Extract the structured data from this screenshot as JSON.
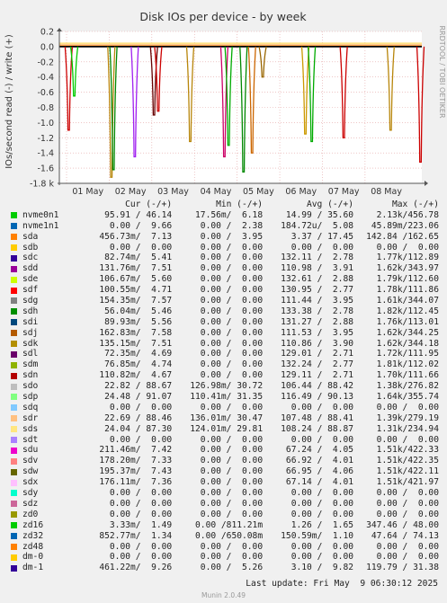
{
  "chart_data": {
    "type": "line",
    "title": "Disk IOs per device - by week",
    "ylabel": "IOs/second read (-) / write (+)",
    "y_ticks": [
      "0.2",
      "0.0",
      "-0.2",
      "-0.4",
      "-0.6",
      "-0.8",
      "-1.0",
      "-1.2",
      "-1.4",
      "-1.6",
      "-1.8 k"
    ],
    "y_tick_values": [
      0.2,
      0.0,
      -0.2,
      -0.4,
      -0.6,
      -0.8,
      -1.0,
      -1.2,
      -1.4,
      -1.6,
      -1.8
    ],
    "ylim": [
      -1.8,
      0.2
    ],
    "x_ticks": [
      "01 May",
      "02 May",
      "03 May",
      "04 May",
      "05 May",
      "06 May",
      "07 May",
      "08 May"
    ],
    "grid": true,
    "spikes": [
      {
        "day": 0.05,
        "value": -1.1,
        "color": "#cc0000"
      },
      {
        "day": 0.18,
        "value": -0.65,
        "color": "#00cc00"
      },
      {
        "day": 1.05,
        "value": -1.72,
        "color": "#b8860b"
      },
      {
        "day": 1.1,
        "value": -1.62,
        "color": "#008800"
      },
      {
        "day": 1.6,
        "value": -1.45,
        "color": "#a020f0"
      },
      {
        "day": 2.05,
        "value": -0.9,
        "color": "#660000"
      },
      {
        "day": 2.15,
        "value": -0.85,
        "color": "#cc0000"
      },
      {
        "day": 2.9,
        "value": -1.25,
        "color": "#b8860b"
      },
      {
        "day": 3.7,
        "value": -1.45,
        "color": "#cc0066"
      },
      {
        "day": 3.8,
        "value": -1.3,
        "color": "#00aa00"
      },
      {
        "day": 4.15,
        "value": -1.65,
        "color": "#008800"
      },
      {
        "day": 4.35,
        "value": -1.4,
        "color": "#cc6600"
      },
      {
        "day": 4.6,
        "value": -0.4,
        "color": "#996600"
      },
      {
        "day": 5.6,
        "value": -1.15,
        "color": "#cc9900"
      },
      {
        "day": 5.75,
        "value": -1.25,
        "color": "#00aa00"
      },
      {
        "day": 6.5,
        "value": -1.2,
        "color": "#cc0000"
      },
      {
        "day": 7.6,
        "value": -1.1,
        "color": "#b8860b"
      },
      {
        "day": 8.3,
        "value": -1.52,
        "color": "#cc0000"
      }
    ]
  },
  "side_text": "RRDTOOL / TOBI OETIKER",
  "legend": {
    "header": {
      "cur": "Cur (-/+)",
      "min": "Min (-/+)",
      "avg": "Avg (-/+)",
      "max": "Max (-/+)"
    },
    "rows": [
      {
        "name": "nvme0n1",
        "color": "#00cc00",
        "cur": "95.91 / 46.14",
        "min": "17.56m/  6.18",
        "avg": "14.99 / 35.60",
        "max": "2.13k/456.78"
      },
      {
        "name": "nvme1n1",
        "color": "#0066b3",
        "cur": "0.00 /  9.66",
        "min": "0.00 /  2.38",
        "avg": "184.72u/  5.08",
        "max": "45.89m/223.06"
      },
      {
        "name": "sda",
        "color": "#ff8000",
        "cur": "456.73m/  7.13",
        "min": "0.00 /  3.95",
        "avg": "3.37 / 17.45",
        "max": "142.84 /162.65"
      },
      {
        "name": "sdb",
        "color": "#ffcc00",
        "cur": "0.00 /  0.00",
        "min": "0.00 /  0.00",
        "avg": "0.00 /  0.00",
        "max": "0.00 /  0.00"
      },
      {
        "name": "sdc",
        "color": "#330099",
        "cur": "82.74m/  5.41",
        "min": "0.00 /  0.00",
        "avg": "132.11 /  2.78",
        "max": "1.77k/112.89"
      },
      {
        "name": "sdd",
        "color": "#990099",
        "cur": "131.76m/  7.51",
        "min": "0.00 /  0.00",
        "avg": "110.98 /  3.91",
        "max": "1.62k/343.97"
      },
      {
        "name": "sde",
        "color": "#ccff00",
        "cur": "106.67m/  5.60",
        "min": "0.00 /  0.00",
        "avg": "132.61 /  2.88",
        "max": "1.79k/112.60"
      },
      {
        "name": "sdf",
        "color": "#ff0000",
        "cur": "100.55m/  4.71",
        "min": "0.00 /  0.00",
        "avg": "130.95 /  2.77",
        "max": "1.78k/111.86"
      },
      {
        "name": "sdg",
        "color": "#808080",
        "cur": "154.35m/  7.57",
        "min": "0.00 /  0.00",
        "avg": "111.44 /  3.95",
        "max": "1.61k/344.07"
      },
      {
        "name": "sdh",
        "color": "#008f00",
        "cur": "56.04m/  5.46",
        "min": "0.00 /  0.00",
        "avg": "133.38 /  2.78",
        "max": "1.82k/112.45"
      },
      {
        "name": "sdi",
        "color": "#00487d",
        "cur": "89.93m/  5.56",
        "min": "0.00 /  0.00",
        "avg": "131.27 /  2.88",
        "max": "1.76k/113.01"
      },
      {
        "name": "sdj",
        "color": "#b35a00",
        "cur": "162.83m/  7.58",
        "min": "0.00 /  0.00",
        "avg": "111.53 /  3.95",
        "max": "1.62k/344.25"
      },
      {
        "name": "sdk",
        "color": "#b38f00",
        "cur": "135.15m/  7.51",
        "min": "0.00 /  0.00",
        "avg": "110.86 /  3.90",
        "max": "1.62k/344.18"
      },
      {
        "name": "sdl",
        "color": "#6b006b",
        "cur": "72.35m/  4.69",
        "min": "0.00 /  0.00",
        "avg": "129.01 /  2.71",
        "max": "1.72k/111.95"
      },
      {
        "name": "sdm",
        "color": "#8fb300",
        "cur": "76.85m/  4.74",
        "min": "0.00 /  0.00",
        "avg": "132.24 /  2.77",
        "max": "1.81k/112.02"
      },
      {
        "name": "sdn",
        "color": "#b30000",
        "cur": "110.82m/  4.67",
        "min": "0.00 /  0.00",
        "avg": "129.11 /  2.71",
        "max": "1.70k/111.66"
      },
      {
        "name": "sdo",
        "color": "#bebebe",
        "cur": "22.82 / 88.67",
        "min": "126.98m/ 30.72",
        "avg": "106.44 / 88.42",
        "max": "1.38k/276.82"
      },
      {
        "name": "sdp",
        "color": "#80ff80",
        "cur": "24.48 / 91.07",
        "min": "110.41m/ 31.35",
        "avg": "116.49 / 90.13",
        "max": "1.64k/355.74"
      },
      {
        "name": "sdq",
        "color": "#80c9ff",
        "cur": "0.00 /  0.00",
        "min": "0.00 /  0.00",
        "avg": "0.00 /  0.00",
        "max": "0.00 /  0.00"
      },
      {
        "name": "sdr",
        "color": "#ffc080",
        "cur": "22.69 / 88.46",
        "min": "136.01m/ 30.47",
        "avg": "107.48 / 88.41",
        "max": "1.39k/279.19"
      },
      {
        "name": "sds",
        "color": "#ffe680",
        "cur": "24.04 / 87.30",
        "min": "124.01m/ 29.81",
        "avg": "108.24 / 88.87",
        "max": "1.31k/234.94"
      },
      {
        "name": "sdt",
        "color": "#aa80ff",
        "cur": "0.00 /  0.00",
        "min": "0.00 /  0.00",
        "avg": "0.00 /  0.00",
        "max": "0.00 /  0.00"
      },
      {
        "name": "sdu",
        "color": "#ee00cc",
        "cur": "211.46m/  7.42",
        "min": "0.00 /  0.00",
        "avg": "67.24 /  4.05",
        "max": "1.51k/422.33"
      },
      {
        "name": "sdv",
        "color": "#ff8080",
        "cur": "178.20m/  7.33",
        "min": "0.00 /  0.00",
        "avg": "66.92 /  4.01",
        "max": "1.51k/422.35"
      },
      {
        "name": "sdw",
        "color": "#666600",
        "cur": "195.37m/  7.43",
        "min": "0.00 /  0.00",
        "avg": "66.95 /  4.06",
        "max": "1.51k/422.11"
      },
      {
        "name": "sdx",
        "color": "#ffbfff",
        "cur": "176.11m/  7.36",
        "min": "0.00 /  0.00",
        "avg": "67.14 /  4.01",
        "max": "1.51k/421.97"
      },
      {
        "name": "sdy",
        "color": "#00ffcc",
        "cur": "0.00 /  0.00",
        "min": "0.00 /  0.00",
        "avg": "0.00 /  0.00",
        "max": "0.00 /  0.00"
      },
      {
        "name": "sdz",
        "color": "#cc6699",
        "cur": "0.00 /  0.00",
        "min": "0.00 /  0.00",
        "avg": "0.00 /  0.00",
        "max": "0.00 /  0.00"
      },
      {
        "name": "zd0",
        "color": "#999900",
        "cur": "0.00 /  0.00",
        "min": "0.00 /  0.00",
        "avg": "0.00 /  0.00",
        "max": "0.00 /  0.00"
      },
      {
        "name": "zd16",
        "color": "#00cc00",
        "cur": "3.33m/  1.49",
        "min": "0.00 /811.21m",
        "avg": "1.26 /  1.65",
        "max": "347.46 / 48.00"
      },
      {
        "name": "zd32",
        "color": "#0066b3",
        "cur": "852.77m/  1.34",
        "min": "0.00 /650.08m",
        "avg": "150.59m/  1.10",
        "max": "47.64 / 74.13"
      },
      {
        "name": "zd48",
        "color": "#ff8000",
        "cur": "0.00 /  0.00",
        "min": "0.00 /  0.00",
        "avg": "0.00 /  0.00",
        "max": "0.00 /  0.00"
      },
      {
        "name": "dm-0",
        "color": "#ffcc00",
        "cur": "0.00 /  0.00",
        "min": "0.00 /  0.00",
        "avg": "0.00 /  0.00",
        "max": "0.00 /  0.00"
      },
      {
        "name": "dm-1",
        "color": "#330099",
        "cur": "461.22m/  9.26",
        "min": "0.00 /  5.26",
        "avg": "3.10 /  9.82",
        "max": "119.79 / 31.38"
      }
    ]
  },
  "footer": {
    "last_update": "Last update: Fri May  9 06:30:12 2025",
    "munin": "Munin 2.0.49"
  }
}
